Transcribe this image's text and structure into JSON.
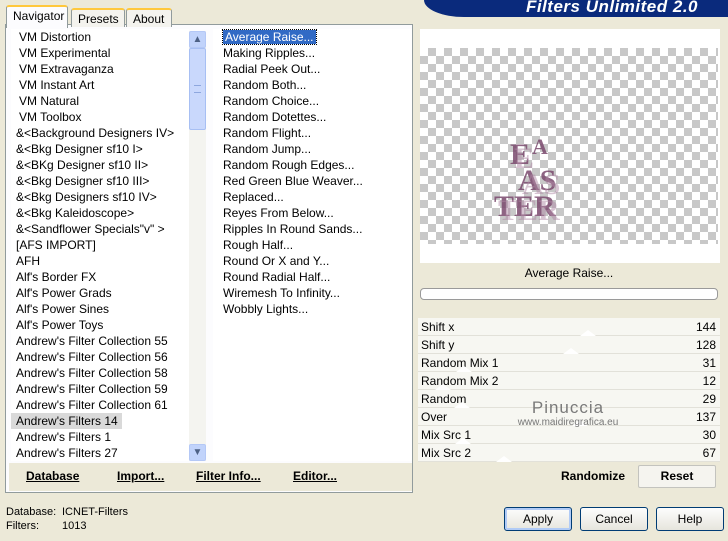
{
  "header": {
    "title": "Filters Unlimited 2.0"
  },
  "tabs": [
    {
      "label": "Navigator",
      "active": true
    },
    {
      "label": "Presets",
      "active": false
    },
    {
      "label": "About",
      "active": false
    }
  ],
  "categories": {
    "items": [
      "VM Distortion",
      "VM Experimental",
      "VM Extravaganza",
      "VM Instant Art",
      "VM Natural",
      "VM Toolbox",
      "&<Background Designers IV>",
      "&<Bkg Designer sf10 I>",
      "&<BKg Designer sf10 II>",
      "&<Bkg Designer sf10 III>",
      "&<Bkg Designers sf10 IV>",
      "&<Bkg Kaleidoscope>",
      "&<Sandflower Specials\"v\" >",
      "[AFS IMPORT]",
      "AFH",
      "Alf's Border FX",
      "Alf's Power Grads",
      "Alf's Power Sines",
      "Alf's Power Toys",
      "Andrew's Filter Collection 55",
      "Andrew's Filter Collection 56",
      "Andrew's Filter Collection 58",
      "Andrew's Filter Collection 59",
      "Andrew's Filter Collection 61",
      "Andrew's Filters 14",
      "Andrew's Filters 1",
      "Andrew's Filters 27"
    ],
    "selected": "Andrew's Filters 14"
  },
  "filters": {
    "items": [
      "Average Raise...",
      "Making Ripples...",
      "Radial Peek Out...",
      "Random Both...",
      "Random Choice...",
      "Random Dotettes...",
      "Random Flight...",
      "Random Jump...",
      "Random Rough Edges...",
      "Red Green Blue Weaver...",
      "Replaced...",
      "Reyes From Below...",
      "Ripples In Round Sands...",
      "Rough Half...",
      "Round Or X and Y...",
      "Round Radial Half...",
      "Wiremesh To Infinity...",
      "Wobbly Lights..."
    ],
    "selected": "Average Raise..."
  },
  "toolbar": {
    "database": "Database",
    "import": "Import...",
    "filter_info": "Filter Info...",
    "editor": "Editor..."
  },
  "preview": {
    "filter_name": "Average Raise...",
    "text": "EASTER"
  },
  "parameters": [
    {
      "label": "Shift x",
      "value": "144",
      "level": 144
    },
    {
      "label": "Shift y",
      "value": "128",
      "level": 128
    },
    {
      "label": "Random Mix 1",
      "value": "31",
      "level": 31
    },
    {
      "label": "Random Mix 2",
      "value": "12",
      "level": 12
    },
    {
      "label": "Random",
      "value": "29",
      "level": 29
    },
    {
      "label": "Over",
      "value": "137",
      "level": 137
    },
    {
      "label": "Mix Src 1",
      "value": "30",
      "level": 30
    },
    {
      "label": "Mix Src 2",
      "value": "67",
      "level": 67
    }
  ],
  "watermark": {
    "line1": "Pinuccia",
    "line2": "www.maidiregrafica.eu"
  },
  "actions": {
    "randomize": "Randomize",
    "reset": "Reset"
  },
  "status": {
    "database_label": "Database:",
    "database_value": "ICNET-Filters",
    "filters_label": "Filters:",
    "filters_value": "1013"
  },
  "buttons": {
    "apply": "Apply",
    "cancel": "Cancel",
    "help": "Help"
  },
  "colors": {
    "selection": "#316ac5",
    "banner": "#0a2a7c",
    "tab_highlight": "#ffc83c",
    "text_preview": "#7b4a6e"
  }
}
